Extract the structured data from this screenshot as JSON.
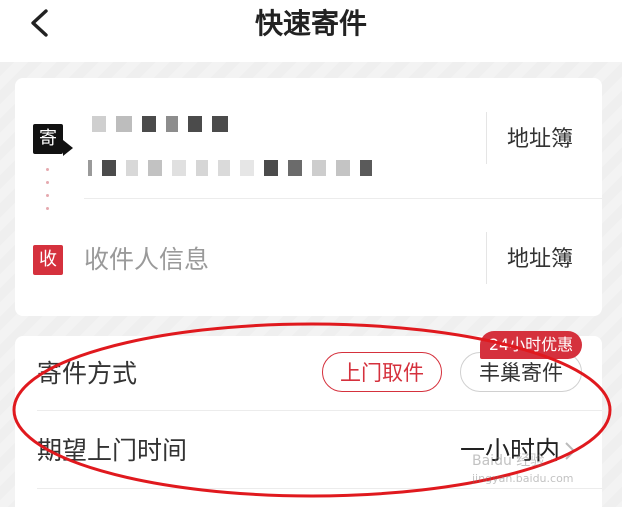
{
  "header": {
    "title": "快速寄件"
  },
  "sender": {
    "tag": "寄",
    "address_book": "地址簿"
  },
  "receiver": {
    "tag": "收",
    "placeholder": "收件人信息",
    "address_book": "地址簿"
  },
  "shipping": {
    "label": "寄件方式",
    "options": [
      {
        "label": "上门取件",
        "selected": true
      },
      {
        "label": "丰巢寄件",
        "selected": false
      }
    ],
    "promo_badge": "24小时优惠"
  },
  "pickup_time": {
    "label": "期望上门时间",
    "value": "一小时内"
  },
  "watermark": {
    "brand": "Baidu 经验",
    "url": "jingyan.baidu.com"
  },
  "colors": {
    "accent": "#d5313d",
    "annotation": "#e0191e"
  }
}
